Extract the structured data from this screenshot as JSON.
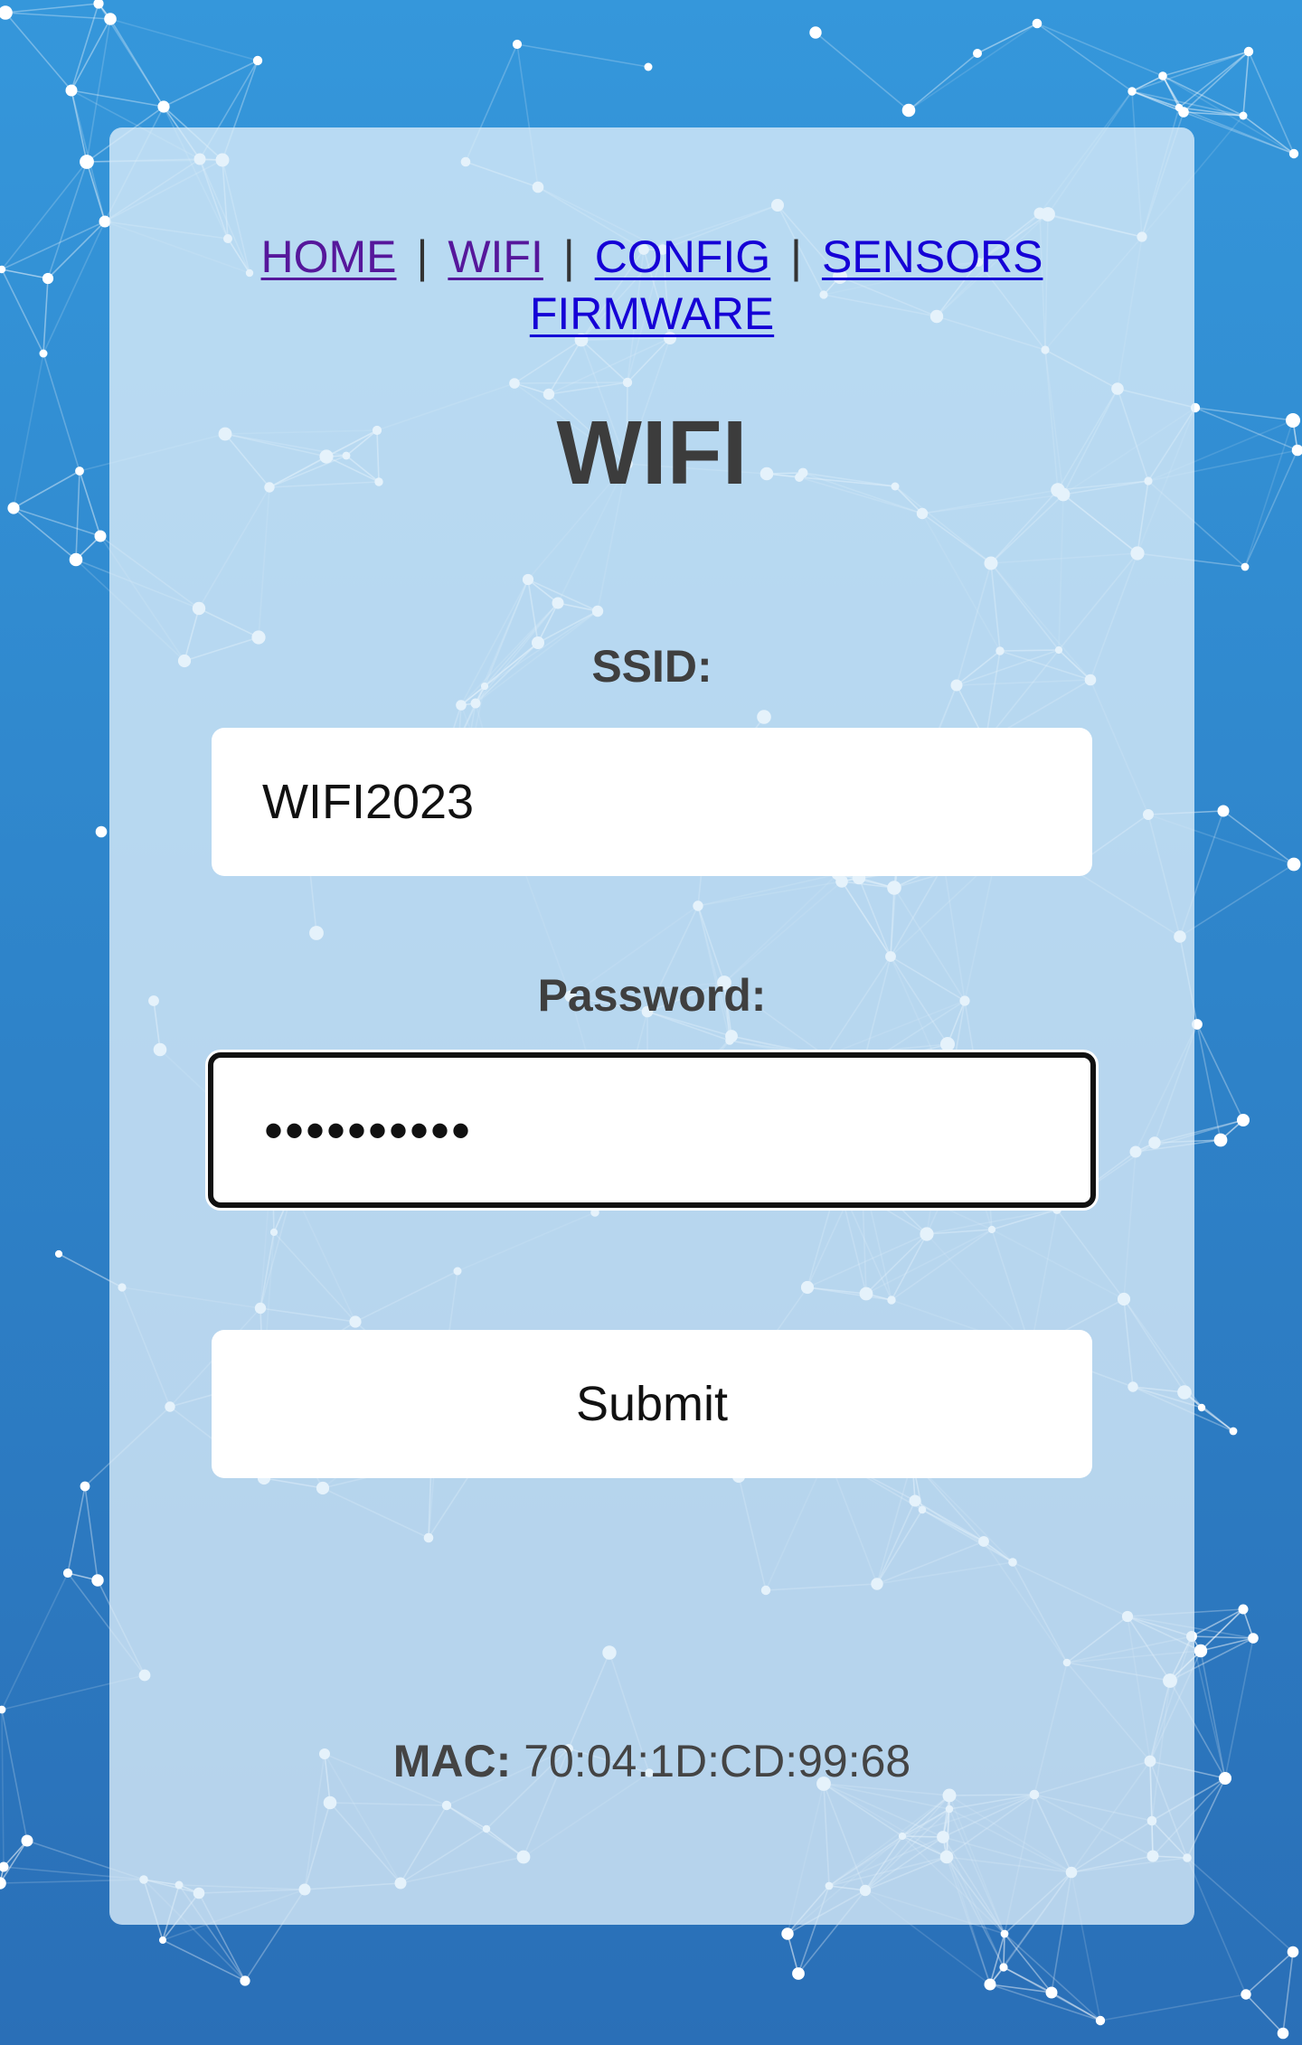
{
  "nav": {
    "items": [
      {
        "label": "HOME"
      },
      {
        "label": "WIFI"
      },
      {
        "label": "CONFIG"
      },
      {
        "label": "SENSORS"
      },
      {
        "label": "FIRMWARE"
      }
    ],
    "separator": "|"
  },
  "page": {
    "title": "WIFI"
  },
  "form": {
    "ssid_label": "SSID:",
    "ssid_value": "WIFI2023",
    "password_label": "Password:",
    "password_value": "••••••••••",
    "submit_label": "Submit"
  },
  "footer": {
    "mac_label": "MAC:",
    "mac_value": "70:04:1D:CD:99:68"
  },
  "colors": {
    "background_top": "#3597db",
    "background_bottom": "#2a6fb7",
    "link": "#1500d6",
    "link_visited": "#56179b",
    "title": "#3c3c3c"
  }
}
